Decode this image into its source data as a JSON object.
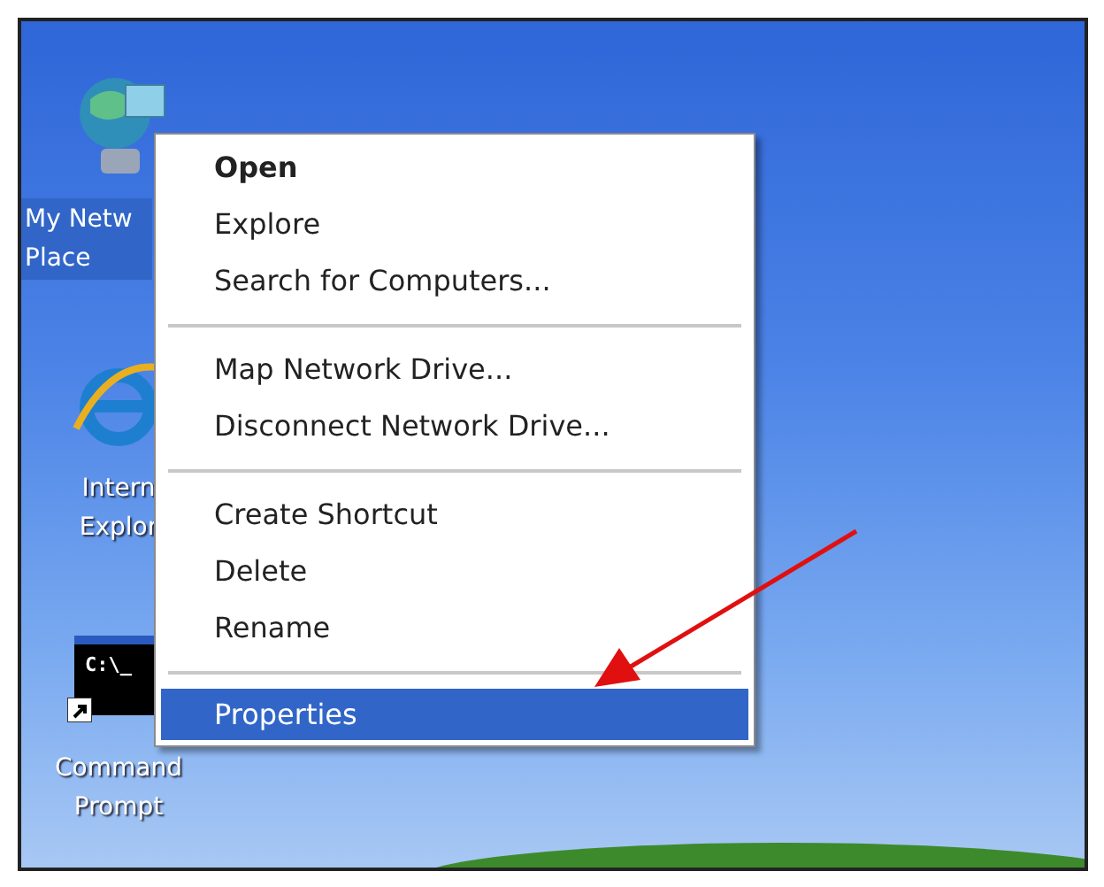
{
  "desktop_icons": [
    {
      "kind": "network",
      "label_lines": [
        "My Netw",
        "Place"
      ],
      "selected": true
    },
    {
      "kind": "browser",
      "label_lines": [
        "Intern",
        "Explor"
      ],
      "selected": false
    },
    {
      "kind": "console",
      "screen_text": "C:\\_",
      "label_lines": [
        "Command",
        "Prompt"
      ],
      "selected": false
    }
  ],
  "context_menu": {
    "items": [
      {
        "kind": "item",
        "label": "Open",
        "default": true,
        "selected": false
      },
      {
        "kind": "item",
        "label": "Explore",
        "default": false,
        "selected": false
      },
      {
        "kind": "item",
        "label": "Search for Computers...",
        "default": false,
        "selected": false
      },
      {
        "kind": "separator"
      },
      {
        "kind": "item",
        "label": "Map Network Drive...",
        "default": false,
        "selected": false
      },
      {
        "kind": "item",
        "label": "Disconnect Network Drive...",
        "default": false,
        "selected": false
      },
      {
        "kind": "separator"
      },
      {
        "kind": "item",
        "label": "Create Shortcut",
        "default": false,
        "selected": false
      },
      {
        "kind": "item",
        "label": "Delete",
        "default": false,
        "selected": false
      },
      {
        "kind": "item",
        "label": "Rename",
        "default": false,
        "selected": false
      },
      {
        "kind": "separator"
      },
      {
        "kind": "item",
        "label": "Properties",
        "default": false,
        "selected": true
      }
    ]
  },
  "annotation": {
    "kind": "arrow",
    "color": "#e01010"
  }
}
